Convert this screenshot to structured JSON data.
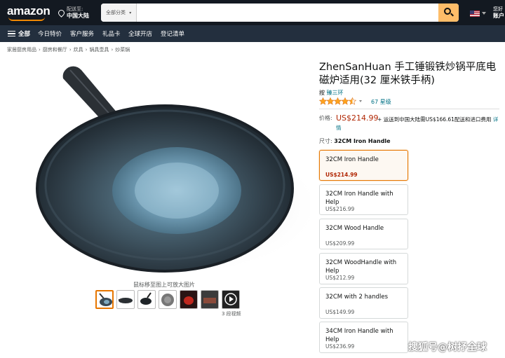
{
  "header": {
    "logo": "amazon",
    "deliver_line1": "配送至:",
    "deliver_line2": "中国大陆",
    "search_category": "全部分类",
    "search_placeholder": "",
    "account_line1": "您好",
    "account_line2": "账户"
  },
  "subnav": {
    "items": [
      "全部",
      "今日特价",
      "客户服务",
      "礼品卡",
      "全球开店",
      "登记清单"
    ]
  },
  "breadcrumb": [
    "家居厨房用品",
    "厨房和餐厅",
    "炊具",
    "锅具壶具",
    "炒菜锅"
  ],
  "gallery": {
    "zoom_hint": "鼠标移至图上可放大图片",
    "video_count": "3 段视频",
    "thumbnails": [
      "wok-main",
      "wok-with-lid",
      "wok-side",
      "wok-top",
      "wok-red",
      "wok-cooking",
      "video"
    ]
  },
  "product": {
    "title": "ZhenSanHuan 手工锤锻铁炒锅平底电磁炉适用(32 厘米铁手柄)",
    "brand_prefix": "按",
    "brand": "臻三环",
    "rating": 4.5,
    "ratings_count": "67 星级",
    "price_label": "价格:",
    "price": "US$214.99",
    "shipping_text": "+ 运送到中国大陆需US$166.61配送和进口费用",
    "shipping_link": "详情",
    "size_label": "尺寸:",
    "size_value": "32CM Iron Handle",
    "options": [
      {
        "name": "32CM Iron Handle",
        "price": "US$214.99",
        "selected": true
      },
      {
        "name": "32CM Iron Handle with Help",
        "price": "US$216.99",
        "selected": false
      },
      {
        "name": "32CM Wood Handle",
        "price": "US$209.99",
        "selected": false
      },
      {
        "name": "32CM WoodHandle with Help",
        "price": "US$212.99",
        "selected": false
      },
      {
        "name": "32CM with 2 handles",
        "price": "US$149.99",
        "selected": false
      },
      {
        "name": "34CM Iron Handle with Help",
        "price": "US$236.99",
        "selected": false
      }
    ]
  },
  "watermark": "搜狐号@树抒全球",
  "colors": {
    "nav_dark": "#131921",
    "nav_sub": "#232f3e",
    "search_button": "#febd69",
    "price_red": "#b12704",
    "link_teal": "#007185",
    "star_orange": "#ffa41c",
    "selected_border": "#e77600"
  }
}
